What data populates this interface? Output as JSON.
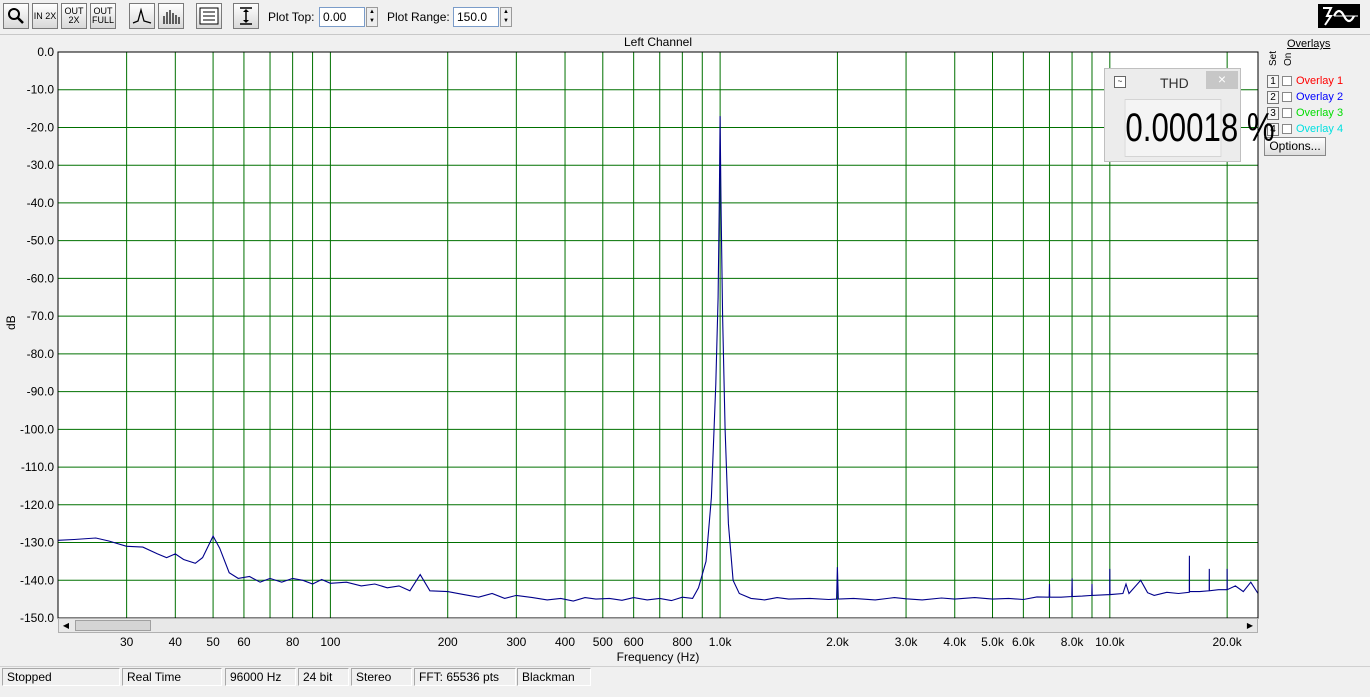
{
  "toolbar": {
    "buttons": [
      {
        "name": "zoom-tool-button",
        "icon": "magnifier-icon"
      },
      {
        "name": "zoom-in-2x-button",
        "icon": "zoom-in-2x-icon",
        "label": "IN 2X"
      },
      {
        "name": "zoom-out-2x-button",
        "icon": "zoom-out-2x-icon",
        "label": "OUT 2X"
      },
      {
        "name": "zoom-out-full-button",
        "icon": "zoom-out-full-icon",
        "label": "OUT FULL"
      },
      {
        "name": "line-mode-button",
        "icon": "peak-line-icon"
      },
      {
        "name": "bar-mode-button",
        "icon": "bar-spectrum-icon"
      },
      {
        "name": "settings-panel-button",
        "icon": "panel-icon"
      },
      {
        "name": "autoscale-button",
        "icon": "vertical-range-icon"
      }
    ],
    "plot_top_label": "Plot Top:",
    "plot_top_value": "0.00",
    "plot_range_label": "Plot Range:",
    "plot_range_value": "150.0"
  },
  "overlays": {
    "header": "Overlays",
    "set_label": "Set",
    "on_label": "On",
    "items": [
      {
        "num": "1",
        "label": "Overlay 1",
        "color": "#ff0000",
        "checked": false
      },
      {
        "num": "2",
        "label": "Overlay 2",
        "color": "#0000ff",
        "checked": false
      },
      {
        "num": "3",
        "label": "Overlay 3",
        "color": "#00dd00",
        "checked": false
      },
      {
        "num": "4",
        "label": "Overlay 4",
        "color": "#00e0e0",
        "checked": false
      }
    ],
    "options_label": "Options..."
  },
  "thd_window": {
    "title": "THD",
    "value": "0.00018 %",
    "close": "×"
  },
  "status": [
    "Stopped",
    "Real Time",
    "96000 Hz",
    "24 bit",
    "Stereo",
    "FFT: 65536 pts",
    "Blackman"
  ],
  "chart_data": {
    "type": "line",
    "title": "Left Channel",
    "xlabel": "Frequency (Hz)",
    "ylabel": "dB",
    "xscale": "log",
    "xlim": [
      20,
      24000
    ],
    "ylim": [
      -150,
      0
    ],
    "grid": true,
    "grid_color": "#007000",
    "line_color": "#00008b",
    "y_ticks": [
      "0.0",
      "-10.0",
      "-20.0",
      "-30.0",
      "-40.0",
      "-50.0",
      "-60.0",
      "-70.0",
      "-80.0",
      "-90.0",
      "-100.0",
      "-110.0",
      "-120.0",
      "-130.0",
      "-140.0",
      "-150.0"
    ],
    "x_ticks": [
      {
        "v": 30,
        "l": "30"
      },
      {
        "v": 40,
        "l": "40"
      },
      {
        "v": 50,
        "l": "50"
      },
      {
        "v": 60,
        "l": "60"
      },
      {
        "v": 80,
        "l": "80"
      },
      {
        "v": 100,
        "l": "100"
      },
      {
        "v": 200,
        "l": "200"
      },
      {
        "v": 300,
        "l": "300"
      },
      {
        "v": 400,
        "l": "400"
      },
      {
        "v": 500,
        "l": "500"
      },
      {
        "v": 600,
        "l": "600"
      },
      {
        "v": 800,
        "l": "800"
      },
      {
        "v": 1000,
        "l": "1.0k"
      },
      {
        "v": 2000,
        "l": "2.0k"
      },
      {
        "v": 3000,
        "l": "3.0k"
      },
      {
        "v": 4000,
        "l": "4.0k"
      },
      {
        "v": 5000,
        "l": "5.0k"
      },
      {
        "v": 6000,
        "l": "6.0k"
      },
      {
        "v": 8000,
        "l": "8.0k"
      },
      {
        "v": 10000,
        "l": "10.0k"
      },
      {
        "v": 20000,
        "l": "20.0k"
      }
    ],
    "x_grid": [
      30,
      40,
      50,
      60,
      70,
      80,
      90,
      100,
      200,
      300,
      400,
      500,
      600,
      700,
      800,
      900,
      1000,
      2000,
      3000,
      4000,
      5000,
      6000,
      7000,
      8000,
      9000,
      10000,
      20000
    ],
    "series": [
      {
        "color": "#00008b",
        "points": [
          [
            20,
            -129.4
          ],
          [
            22,
            -129.2
          ],
          [
            25,
            -128.8
          ],
          [
            27,
            -129.6
          ],
          [
            30,
            -131.0
          ],
          [
            33,
            -131.2
          ],
          [
            36,
            -133.0
          ],
          [
            38,
            -134.0
          ],
          [
            40,
            -133.0
          ],
          [
            42,
            -134.5
          ],
          [
            45,
            -135.5
          ],
          [
            47,
            -134.0
          ],
          [
            50,
            -128.3
          ],
          [
            52,
            -131.5
          ],
          [
            55,
            -138.0
          ],
          [
            58,
            -139.5
          ],
          [
            62,
            -139.0
          ],
          [
            66,
            -140.5
          ],
          [
            70,
            -139.5
          ],
          [
            75,
            -140.5
          ],
          [
            80,
            -139.5
          ],
          [
            85,
            -140.0
          ],
          [
            90,
            -141.0
          ],
          [
            95,
            -139.8
          ],
          [
            100,
            -140.8
          ],
          [
            110,
            -140.5
          ],
          [
            120,
            -141.5
          ],
          [
            130,
            -141.0
          ],
          [
            140,
            -142.0
          ],
          [
            150,
            -141.5
          ],
          [
            160,
            -142.8
          ],
          [
            170,
            -138.5
          ],
          [
            180,
            -142.8
          ],
          [
            200,
            -143.0
          ],
          [
            220,
            -143.8
          ],
          [
            240,
            -144.5
          ],
          [
            260,
            -143.5
          ],
          [
            280,
            -144.8
          ],
          [
            300,
            -144.0
          ],
          [
            330,
            -144.6
          ],
          [
            360,
            -145.2
          ],
          [
            390,
            -144.8
          ],
          [
            420,
            -145.5
          ],
          [
            450,
            -144.6
          ],
          [
            480,
            -145.0
          ],
          [
            520,
            -144.8
          ],
          [
            560,
            -145.3
          ],
          [
            600,
            -144.6
          ],
          [
            650,
            -145.2
          ],
          [
            700,
            -144.8
          ],
          [
            750,
            -145.4
          ],
          [
            800,
            -144.5
          ],
          [
            850,
            -144.8
          ],
          [
            880,
            -142.0
          ],
          [
            920,
            -135.0
          ],
          [
            950,
            -118.0
          ],
          [
            975,
            -88.0
          ],
          [
            988,
            -65.0
          ],
          [
            995,
            -40.0
          ],
          [
            1000,
            -17.0
          ],
          [
            1005,
            -40.0
          ],
          [
            1015,
            -70.0
          ],
          [
            1030,
            -100.0
          ],
          [
            1050,
            -125.0
          ],
          [
            1080,
            -140.0
          ],
          [
            1120,
            -143.5
          ],
          [
            1200,
            -144.8
          ],
          [
            1300,
            -145.2
          ],
          [
            1400,
            -144.6
          ],
          [
            1500,
            -145.0
          ],
          [
            1700,
            -144.8
          ],
          [
            1900,
            -145.1
          ],
          [
            1990,
            -145.0
          ],
          [
            2000,
            -136.5
          ],
          [
            2010,
            -145.0
          ],
          [
            2200,
            -144.8
          ],
          [
            2500,
            -145.2
          ],
          [
            2800,
            -144.6
          ],
          [
            3000,
            -144.9
          ],
          [
            3300,
            -145.2
          ],
          [
            3700,
            -144.7
          ],
          [
            4000,
            -145.0
          ],
          [
            4500,
            -144.6
          ],
          [
            5000,
            -145.0
          ],
          [
            5500,
            -144.8
          ],
          [
            6000,
            -145.1
          ],
          [
            6500,
            -144.4
          ],
          [
            6990,
            -144.5
          ],
          [
            7000,
            -141.0
          ],
          [
            7010,
            -144.5
          ],
          [
            7500,
            -144.5
          ],
          [
            7990,
            -144.3
          ],
          [
            8000,
            -139.5
          ],
          [
            8010,
            -144.3
          ],
          [
            8500,
            -144.2
          ],
          [
            8990,
            -144.0
          ],
          [
            9000,
            -141.0
          ],
          [
            9010,
            -144.0
          ],
          [
            9990,
            -143.8
          ],
          [
            10000,
            -137.0
          ],
          [
            10010,
            -143.8
          ],
          [
            10800,
            -143.5
          ],
          [
            11000,
            -141.0
          ],
          [
            11200,
            -143.5
          ],
          [
            12000,
            -140.0
          ],
          [
            12500,
            -143.3
          ],
          [
            13000,
            -144.0
          ],
          [
            14000,
            -143.2
          ],
          [
            15000,
            -143.5
          ],
          [
            15990,
            -143.2
          ],
          [
            16000,
            -133.5
          ],
          [
            16010,
            -143.0
          ],
          [
            17000,
            -143.0
          ],
          [
            17990,
            -142.8
          ],
          [
            18000,
            -137.0
          ],
          [
            18010,
            -142.8
          ],
          [
            19000,
            -142.5
          ],
          [
            19990,
            -142.5
          ],
          [
            20000,
            -137.0
          ],
          [
            20010,
            -142.5
          ],
          [
            21000,
            -141.5
          ],
          [
            22000,
            -143.0
          ],
          [
            23000,
            -140.5
          ],
          [
            24000,
            -143.5
          ]
        ]
      }
    ]
  }
}
